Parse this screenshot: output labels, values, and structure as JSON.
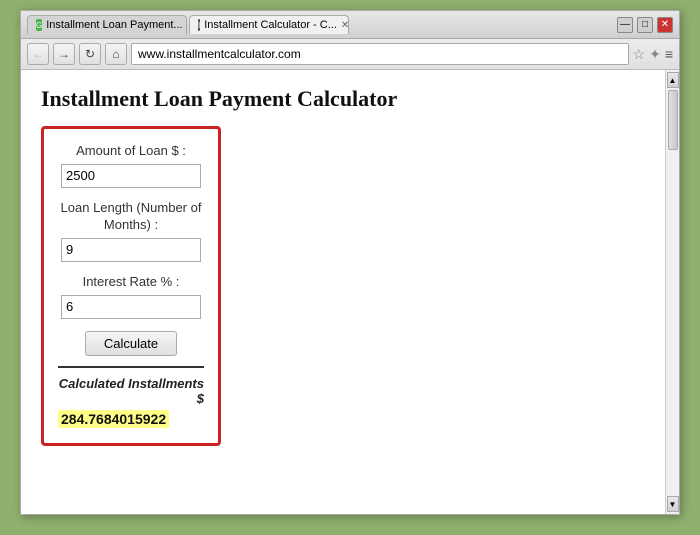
{
  "browser": {
    "tabs": [
      {
        "id": "tab1",
        "label": "Installment Loan Payment...",
        "favicon": "G",
        "active": false
      },
      {
        "id": "tab2",
        "label": "Installment Calculator - C...",
        "favicon": "I",
        "active": true
      }
    ],
    "address": "www.installmentcalculator.com",
    "window_controls": {
      "minimize": "—",
      "maximize": "□",
      "close": "✕"
    }
  },
  "page": {
    "title": "Installment Loan Payment Calculator",
    "calculator": {
      "loan_amount_label": "Amount of Loan $ :",
      "loan_amount_value": "2500",
      "loan_length_label": "Loan Length (Number of Months) :",
      "loan_length_value": "9",
      "interest_rate_label": "Interest Rate % :",
      "interest_rate_value": "6",
      "calculate_button": "Calculate",
      "result_label": "Calculated Installments $",
      "result_value": "284.7684015922"
    }
  }
}
